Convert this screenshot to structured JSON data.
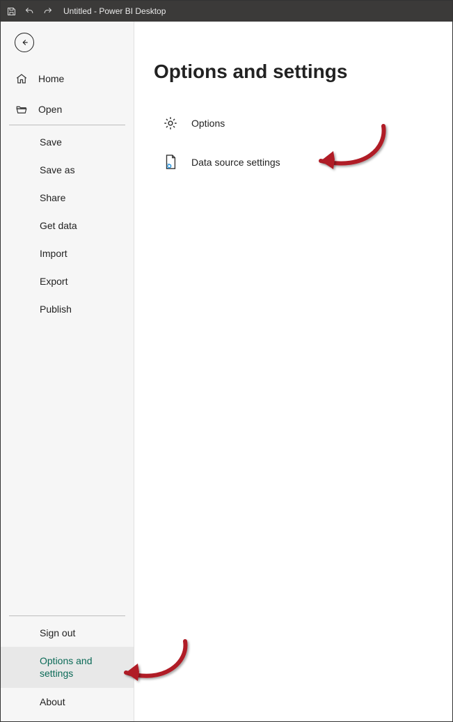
{
  "titlebar": {
    "title": "Untitled - Power BI Desktop"
  },
  "sidebar": {
    "home": "Home",
    "open": "Open",
    "save": "Save",
    "save_as": "Save as",
    "share": "Share",
    "get_data": "Get data",
    "import": "Import",
    "export": "Export",
    "publish": "Publish",
    "sign_out": "Sign out",
    "options_and_settings": "Options and settings",
    "about": "About"
  },
  "main": {
    "heading": "Options and settings",
    "options": "Options",
    "data_source_settings": "Data source settings"
  }
}
